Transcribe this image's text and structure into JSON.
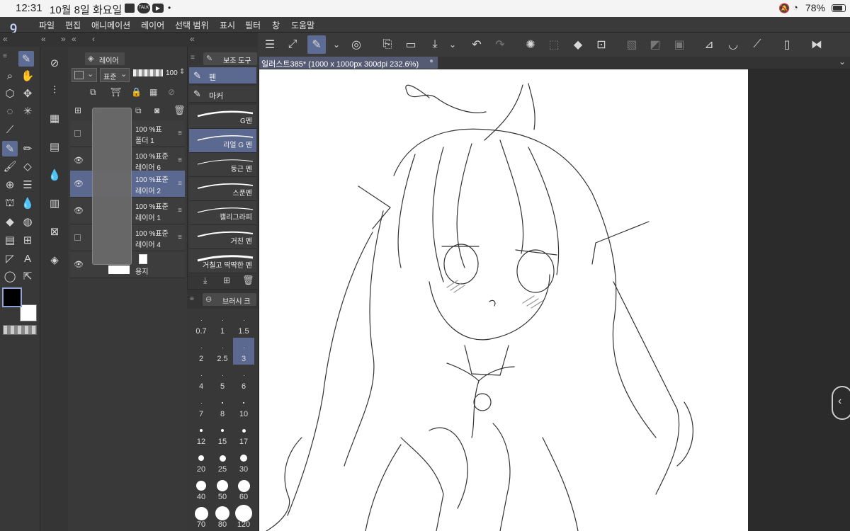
{
  "status_bar": {
    "time": "12:31",
    "date": "10월 8일 화요일",
    "notif_talk": "TALK",
    "dot": "•",
    "battery": "78%"
  },
  "menu": {
    "items": [
      "파일",
      "편집",
      "애니메이션",
      "레이어",
      "선택 범위",
      "표시",
      "필터",
      "창",
      "도움말"
    ]
  },
  "layer_panel": {
    "title": "레이어",
    "blend_mode": "표준",
    "opacity": "100",
    "layers": [
      {
        "pct": "100 %표",
        "name": "폴더 1",
        "visible": false,
        "selected": false
      },
      {
        "pct": "100 %표준",
        "name": "레이어 6",
        "visible": true,
        "selected": false
      },
      {
        "pct": "100 %표준",
        "name": "레이어 2",
        "visible": true,
        "selected": true
      },
      {
        "pct": "100 %표준",
        "name": "레이어 1",
        "visible": true,
        "selected": false
      },
      {
        "pct": "100 %표준",
        "name": "레이어 4",
        "visible": false,
        "selected": false
      },
      {
        "pct": "",
        "name": "용지",
        "visible": true,
        "selected": false
      }
    ]
  },
  "sub_tool_panel": {
    "title": "보조 도구",
    "groups": [
      {
        "label": "펜",
        "selected": true
      },
      {
        "label": "마커",
        "selected": false
      }
    ],
    "brushes": [
      {
        "name": "G펜",
        "selected": false
      },
      {
        "name": "리얼 G 펜",
        "selected": true
      },
      {
        "name": "둥근 펜",
        "selected": false
      },
      {
        "name": "스푼펜",
        "selected": false
      },
      {
        "name": "캘리그라피",
        "selected": false
      },
      {
        "name": "거친 펜",
        "selected": false
      },
      {
        "name": "거칠고 딱딱한 펜",
        "selected": false
      }
    ]
  },
  "brush_size_panel": {
    "title": "브러시 크",
    "sizes": [
      "0.7",
      "1",
      "1.5",
      "2",
      "2.5",
      "3",
      "4",
      "5",
      "6",
      "7",
      "8",
      "10",
      "12",
      "15",
      "17",
      "20",
      "25",
      "30",
      "40",
      "50",
      "60",
      "70",
      "80",
      "120"
    ],
    "selected": "3"
  },
  "canvas": {
    "tab_title": "일러스트385* (1000 x 1000px 300dpi 232.6%)"
  },
  "colors": {
    "accent": "#5b6890",
    "panel": "#393939",
    "canvas_bg": "#2b2b2b",
    "main_color": "#000000",
    "sub_color": "#ffffff"
  }
}
